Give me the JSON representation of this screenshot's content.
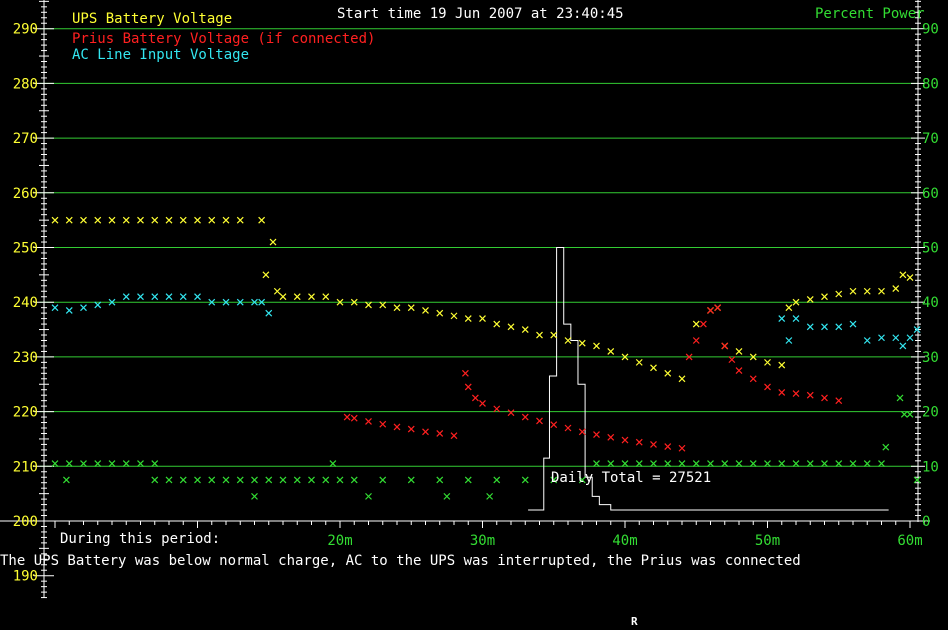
{
  "header": {
    "start_time": "Start time 19 Jun 2007 at 23:40:45",
    "right_axis_title": "Percent Power",
    "bottom_marker": "R"
  },
  "legend": {
    "ups": "UPS Battery Voltage",
    "prius": "Prius Battery Voltage (if connected)",
    "ac": "AC Line Input Voltage"
  },
  "footer": {
    "period_label": "During this period:",
    "summary": "The UPS Battery was below normal charge, AC to the UPS was interrupted, the Prius was connected",
    "daily_total": "Daily Total = 27521"
  },
  "colors": {
    "ups": "#ffff33",
    "prius": "#ff2020",
    "ac": "#33e6f0",
    "power": "#33dd33",
    "grid": "#33cc33",
    "hist": "#ffffff",
    "axis": "#ffffff",
    "left_ticks": "#ffff33",
    "right_ticks": "#33dd33"
  },
  "chart_data": {
    "type": "scatter",
    "title": "Start time 19 Jun 2007 at 23:40:45",
    "x_unit": "minutes",
    "xlim": [
      0,
      61
    ],
    "ylim": [
      200,
      293
    ],
    "y_right_label": "Percent Power",
    "y_right_lim": [
      0,
      93
    ],
    "grid": true,
    "legend_position": "top-left",
    "x_ticks": [
      {
        "value": 20,
        "label": "20m"
      },
      {
        "value": 30,
        "label": "30m"
      },
      {
        "value": 40,
        "label": "40m"
      },
      {
        "value": 50,
        "label": "50m"
      },
      {
        "value": 60,
        "label": "60m"
      }
    ],
    "y_left_ticks": [
      {
        "value": 290,
        "label": "290"
      },
      {
        "value": 280,
        "label": "280"
      },
      {
        "value": 270,
        "label": "270"
      },
      {
        "value": 260,
        "label": "260"
      },
      {
        "value": 250,
        "label": "250"
      },
      {
        "value": 240,
        "label": "240"
      },
      {
        "value": 230,
        "label": "230"
      },
      {
        "value": 220,
        "label": "220"
      },
      {
        "value": 210,
        "label": "210"
      },
      {
        "value": 200,
        "label": "200"
      },
      {
        "value": 190,
        "label": "190"
      }
    ],
    "y_right_ticks": [
      {
        "value": 90,
        "label": "90"
      },
      {
        "value": 80,
        "label": "80"
      },
      {
        "value": 70,
        "label": "70"
      },
      {
        "value": 60,
        "label": "60"
      },
      {
        "value": 50,
        "label": "50"
      },
      {
        "value": 40,
        "label": "40"
      },
      {
        "value": 30,
        "label": "30"
      },
      {
        "value": 20,
        "label": "20"
      },
      {
        "value": 10,
        "label": "10"
      },
      {
        "value": 0,
        "label": "0"
      }
    ],
    "series": [
      {
        "name": "UPS Battery Voltage",
        "axis": "left",
        "points": [
          [
            0,
            255
          ],
          [
            1,
            255
          ],
          [
            2,
            255
          ],
          [
            3,
            255
          ],
          [
            4,
            255
          ],
          [
            5,
            255
          ],
          [
            6,
            255
          ],
          [
            7,
            255
          ],
          [
            8,
            255
          ],
          [
            9,
            255
          ],
          [
            10,
            255
          ],
          [
            11,
            255
          ],
          [
            12,
            255
          ],
          [
            13,
            255
          ],
          [
            14.5,
            255
          ],
          [
            14.8,
            245
          ],
          [
            15.3,
            251
          ],
          [
            15.6,
            242
          ],
          [
            16,
            241
          ],
          [
            17,
            241
          ],
          [
            18,
            241
          ],
          [
            19,
            241
          ],
          [
            20,
            240
          ],
          [
            21,
            240
          ],
          [
            22,
            239.5
          ],
          [
            23,
            239.5
          ],
          [
            24,
            239
          ],
          [
            25,
            239
          ],
          [
            26,
            238.5
          ],
          [
            27,
            238
          ],
          [
            28,
            237.5
          ],
          [
            29,
            237
          ],
          [
            30,
            237
          ],
          [
            31,
            236
          ],
          [
            32,
            235.5
          ],
          [
            33,
            235
          ],
          [
            34,
            234
          ],
          [
            35,
            234
          ],
          [
            36,
            233
          ],
          [
            37,
            232.5
          ],
          [
            38,
            232
          ],
          [
            39,
            231
          ],
          [
            40,
            230
          ],
          [
            41,
            229
          ],
          [
            42,
            228
          ],
          [
            43,
            227
          ],
          [
            44,
            226
          ],
          [
            45,
            236
          ],
          [
            46,
            238.5
          ],
          [
            46.5,
            239
          ],
          [
            47,
            232
          ],
          [
            48,
            231
          ],
          [
            49,
            230
          ],
          [
            50,
            229
          ],
          [
            51,
            228.5
          ],
          [
            51.5,
            239
          ],
          [
            52,
            240
          ],
          [
            53,
            240.5
          ],
          [
            54,
            241
          ],
          [
            55,
            241.5
          ],
          [
            56,
            242
          ],
          [
            57,
            242
          ],
          [
            58,
            242
          ],
          [
            59,
            242.5
          ],
          [
            59.5,
            245
          ],
          [
            60,
            244.5
          ]
        ]
      },
      {
        "name": "Prius Battery Voltage (if connected)",
        "axis": "left",
        "points": [
          [
            20.5,
            219
          ],
          [
            21,
            218.8
          ],
          [
            22,
            218.2
          ],
          [
            23,
            217.7
          ],
          [
            24,
            217.2
          ],
          [
            25,
            216.8
          ],
          [
            26,
            216.3
          ],
          [
            27,
            216
          ],
          [
            28,
            215.6
          ],
          [
            28.8,
            227
          ],
          [
            29,
            224.5
          ],
          [
            29.5,
            222.5
          ],
          [
            30,
            221.5
          ],
          [
            31,
            220.5
          ],
          [
            32,
            219.8
          ],
          [
            33,
            219
          ],
          [
            34,
            218.3
          ],
          [
            35,
            217.6
          ],
          [
            36,
            217
          ],
          [
            37,
            216.3
          ],
          [
            38,
            215.8
          ],
          [
            39,
            215.3
          ],
          [
            40,
            214.8
          ],
          [
            41,
            214.4
          ],
          [
            42,
            214
          ],
          [
            43,
            213.6
          ],
          [
            44,
            213.3
          ],
          [
            44.5,
            230
          ],
          [
            45,
            233
          ],
          [
            45.5,
            236
          ],
          [
            46,
            238.5
          ],
          [
            46.5,
            239
          ],
          [
            47,
            232
          ],
          [
            47.5,
            229.5
          ],
          [
            48,
            227.5
          ],
          [
            49,
            226
          ],
          [
            50,
            224.5
          ],
          [
            51,
            223.5
          ],
          [
            52,
            223.3
          ],
          [
            53,
            223
          ],
          [
            54,
            222.5
          ],
          [
            55,
            222
          ]
        ]
      },
      {
        "name": "AC Line Input Voltage",
        "axis": "left",
        "points": [
          [
            0,
            239
          ],
          [
            1,
            238.5
          ],
          [
            2,
            239
          ],
          [
            3,
            239.5
          ],
          [
            4,
            240
          ],
          [
            5,
            241
          ],
          [
            6,
            241
          ],
          [
            7,
            241
          ],
          [
            8,
            241
          ],
          [
            9,
            241
          ],
          [
            10,
            241
          ],
          [
            11,
            240
          ],
          [
            12,
            240
          ],
          [
            13,
            240
          ],
          [
            14,
            240
          ],
          [
            14.5,
            240
          ],
          [
            15,
            238
          ],
          [
            51,
            237
          ],
          [
            51.5,
            233
          ],
          [
            52,
            237
          ],
          [
            53,
            235.5
          ],
          [
            54,
            235.5
          ],
          [
            55,
            235.5
          ],
          [
            56,
            236
          ],
          [
            57,
            233
          ],
          [
            58,
            233.5
          ],
          [
            59,
            233.5
          ],
          [
            59.5,
            232
          ],
          [
            60,
            233.5
          ],
          [
            60.5,
            235
          ]
        ]
      },
      {
        "name": "Percent Power",
        "axis": "right",
        "points": [
          [
            0,
            10.5
          ],
          [
            1,
            10.5
          ],
          [
            2,
            10.5
          ],
          [
            3,
            10.5
          ],
          [
            4,
            10.5
          ],
          [
            5,
            10.5
          ],
          [
            6,
            10.5
          ],
          [
            7,
            10.5
          ],
          [
            0.8,
            7.5
          ],
          [
            14,
            4.5
          ],
          [
            19.5,
            10.5
          ],
          [
            7,
            7.5
          ],
          [
            8,
            7.5
          ],
          [
            9,
            7.5
          ],
          [
            10,
            7.5
          ],
          [
            11,
            7.5
          ],
          [
            12,
            7.5
          ],
          [
            13,
            7.5
          ],
          [
            14,
            7.5
          ],
          [
            15,
            7.5
          ],
          [
            16,
            7.5
          ],
          [
            17,
            7.5
          ],
          [
            18,
            7.5
          ],
          [
            19,
            7.5
          ],
          [
            20,
            7.5
          ],
          [
            22,
            4.5
          ],
          [
            27.5,
            4.5
          ],
          [
            30.5,
            4.5
          ],
          [
            21,
            7.5
          ],
          [
            23,
            7.5
          ],
          [
            25,
            7.5
          ],
          [
            27,
            7.5
          ],
          [
            29,
            7.5
          ],
          [
            31,
            7.5
          ],
          [
            33,
            7.5
          ],
          [
            35,
            7.5
          ],
          [
            37,
            7.5
          ],
          [
            38,
            10.5
          ],
          [
            39,
            10.5
          ],
          [
            40,
            10.5
          ],
          [
            41,
            10.5
          ],
          [
            42,
            10.5
          ],
          [
            43,
            10.5
          ],
          [
            44,
            10.5
          ],
          [
            45,
            10.5
          ],
          [
            46,
            10.5
          ],
          [
            47,
            10.5
          ],
          [
            48,
            10.5
          ],
          [
            49,
            10.5
          ],
          [
            50,
            10.5
          ],
          [
            51,
            10.5
          ],
          [
            52,
            10.5
          ],
          [
            53,
            10.5
          ],
          [
            54,
            10.5
          ],
          [
            55,
            10.5
          ],
          [
            56,
            10.5
          ],
          [
            57,
            10.5
          ],
          [
            58,
            10.5
          ],
          [
            58.3,
            13.5
          ],
          [
            59.3,
            22.5
          ],
          [
            59.6,
            19.5
          ],
          [
            60,
            19.5
          ],
          [
            60.5,
            7.5
          ]
        ]
      }
    ],
    "histogram": {
      "name": "Daily Total = 27521",
      "axis": "right",
      "steps": [
        [
          33.2,
          2
        ],
        [
          34.3,
          2
        ],
        [
          34.3,
          11.5
        ],
        [
          34.7,
          11.5
        ],
        [
          34.7,
          26.5
        ],
        [
          35.2,
          26.5
        ],
        [
          35.2,
          50
        ],
        [
          35.7,
          50
        ],
        [
          35.7,
          36
        ],
        [
          36.2,
          36
        ],
        [
          36.2,
          33
        ],
        [
          36.7,
          33
        ],
        [
          36.7,
          25
        ],
        [
          37.2,
          25
        ],
        [
          37.2,
          8
        ],
        [
          37.7,
          8
        ],
        [
          37.7,
          4.5
        ],
        [
          38.2,
          4.5
        ],
        [
          38.2,
          3
        ],
        [
          39,
          3
        ],
        [
          39,
          2
        ],
        [
          58.5,
          2
        ]
      ]
    }
  }
}
